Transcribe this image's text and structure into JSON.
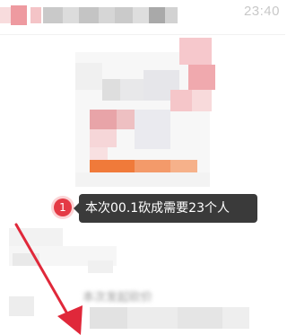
{
  "status_bar": {
    "time": "23:40"
  },
  "tooltip": {
    "step_number": "1",
    "text": "本次00.1砍成需要23个人"
  },
  "blurred_caption": "本次发起砍价",
  "colors": {
    "badge": "#e43a45",
    "tooltip_bg": "#3a3a3a",
    "arrow": "#e0283a",
    "accent_orange": "#f07a3a"
  },
  "icons": [
    "step-badge-icon",
    "pointer-arrow-icon"
  ]
}
